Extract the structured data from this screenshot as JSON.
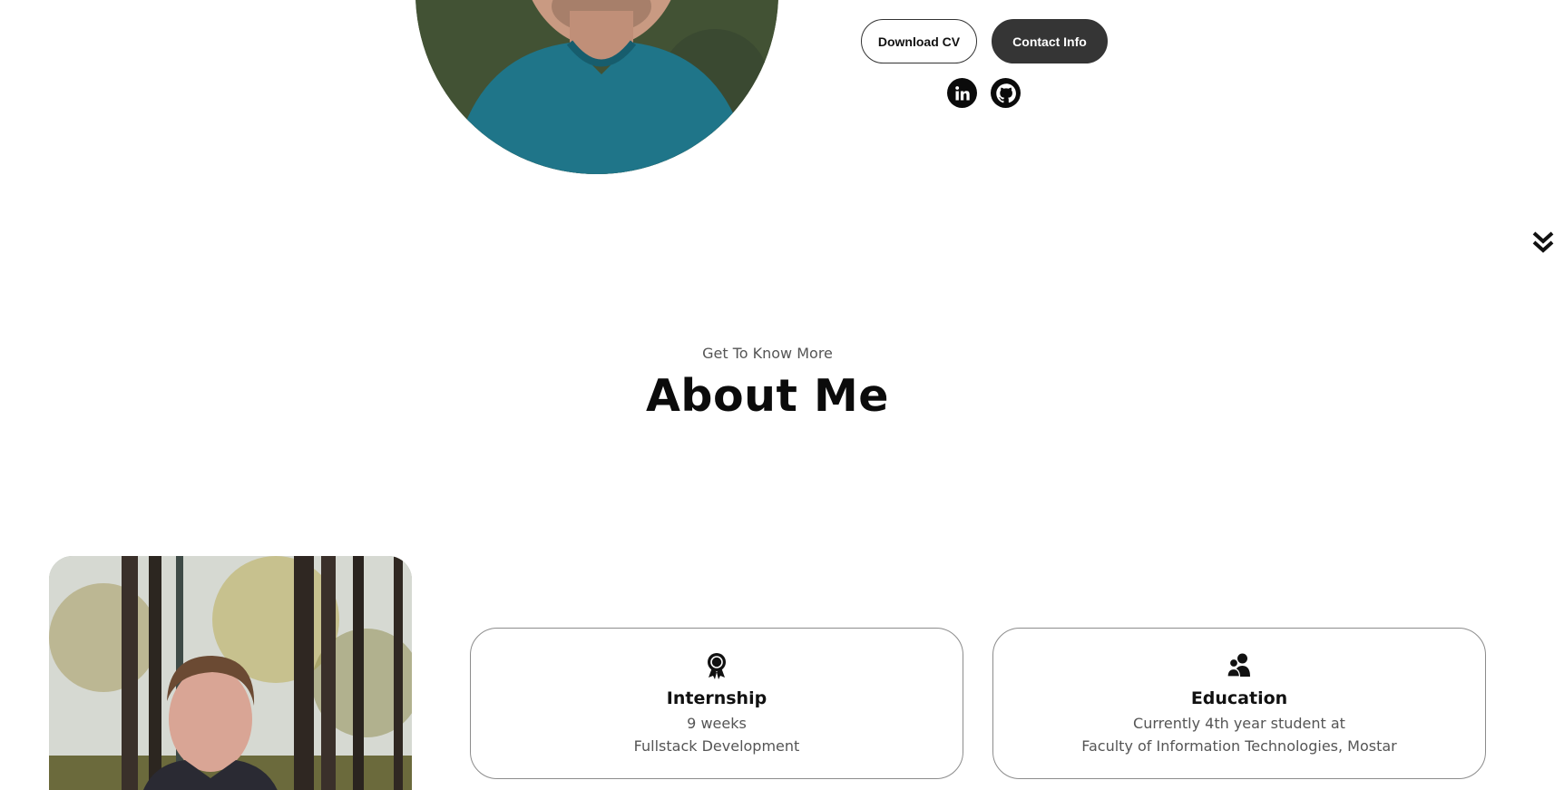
{
  "hero": {
    "download_cv_label": "Download CV",
    "contact_info_label": "Contact Info",
    "social": [
      {
        "icon": "linkedin-icon"
      },
      {
        "icon": "github-icon"
      }
    ]
  },
  "about": {
    "subtitle": "Get To Know More",
    "title": "About Me"
  },
  "cards": {
    "internship": {
      "icon": "award-icon",
      "title": "Internship",
      "line1": "9 weeks",
      "line2": "Fullstack Development"
    },
    "education": {
      "icon": "users-icon",
      "title": "Education",
      "line1": "Currently 4th year student at",
      "line2": "Faculty of Information Technologies, Mostar"
    }
  },
  "colors": {
    "button_dark": "#353535",
    "icon_black": "#0b0b0b",
    "card_border": "#8c8c8c",
    "muted_text": "#555555"
  }
}
